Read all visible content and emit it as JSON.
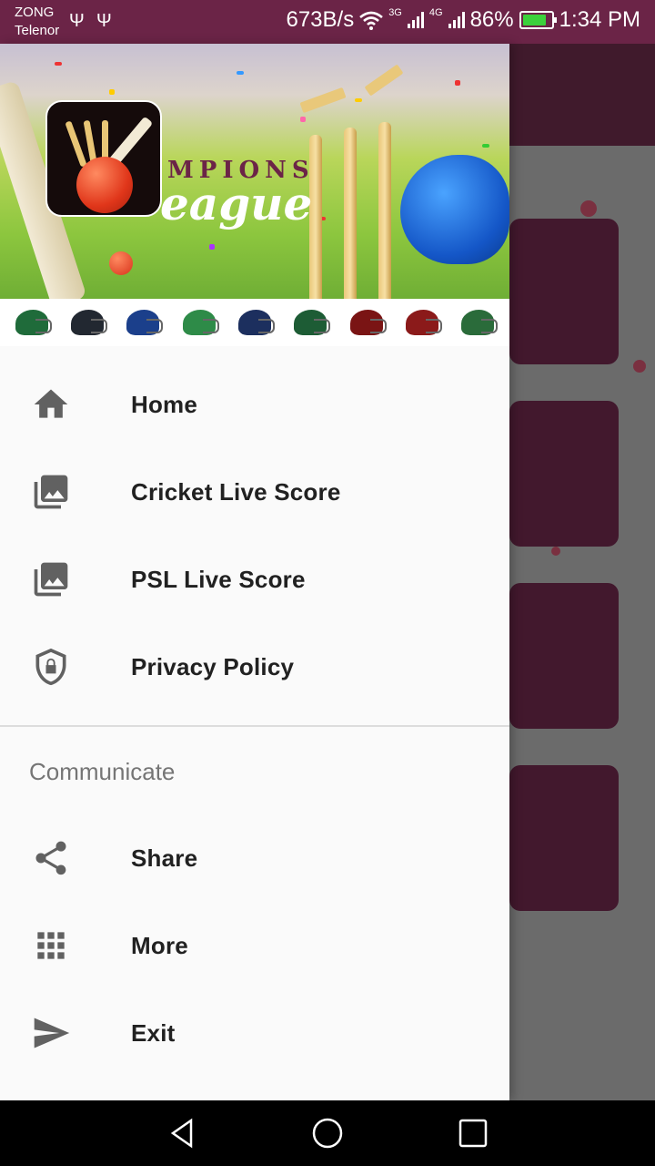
{
  "status_bar": {
    "carrier_1": "ZONG",
    "carrier_2": "Telenor",
    "usb_icons": [
      "usb-icon",
      "usb-icon"
    ],
    "speed": "673B/s",
    "network_1": "3G",
    "network_2": "4G",
    "battery": "86%",
    "battery_level": 0.86,
    "time": "1:34 PM"
  },
  "header": {
    "banner_text_1": "MPIONS",
    "banner_text_2": "eague",
    "helmet_colors": [
      "#1f6b3a",
      "#222831",
      "#1b3f8b",
      "#2e8b48",
      "#1c2f5e",
      "#1d5c35",
      "#7a1414",
      "#8b1a1a",
      "#2a6b3a"
    ]
  },
  "menu": {
    "items": [
      {
        "label": "Home",
        "icon": "home-icon"
      },
      {
        "label": "Cricket Live Score",
        "icon": "photo-library-icon"
      },
      {
        "label": "PSL Live Score",
        "icon": "photo-library-icon"
      },
      {
        "label": "Privacy Policy",
        "icon": "shield-lock-icon"
      }
    ],
    "section_title": "Communicate",
    "section_items": [
      {
        "label": "Share",
        "icon": "share-icon"
      },
      {
        "label": "More",
        "icon": "apps-grid-icon"
      },
      {
        "label": "Exit",
        "icon": "send-icon"
      }
    ]
  },
  "colors": {
    "primary": "#6b2447",
    "primary_dark": "#401a2c",
    "drawer_bg": "#fafafa",
    "icon": "#616161"
  }
}
